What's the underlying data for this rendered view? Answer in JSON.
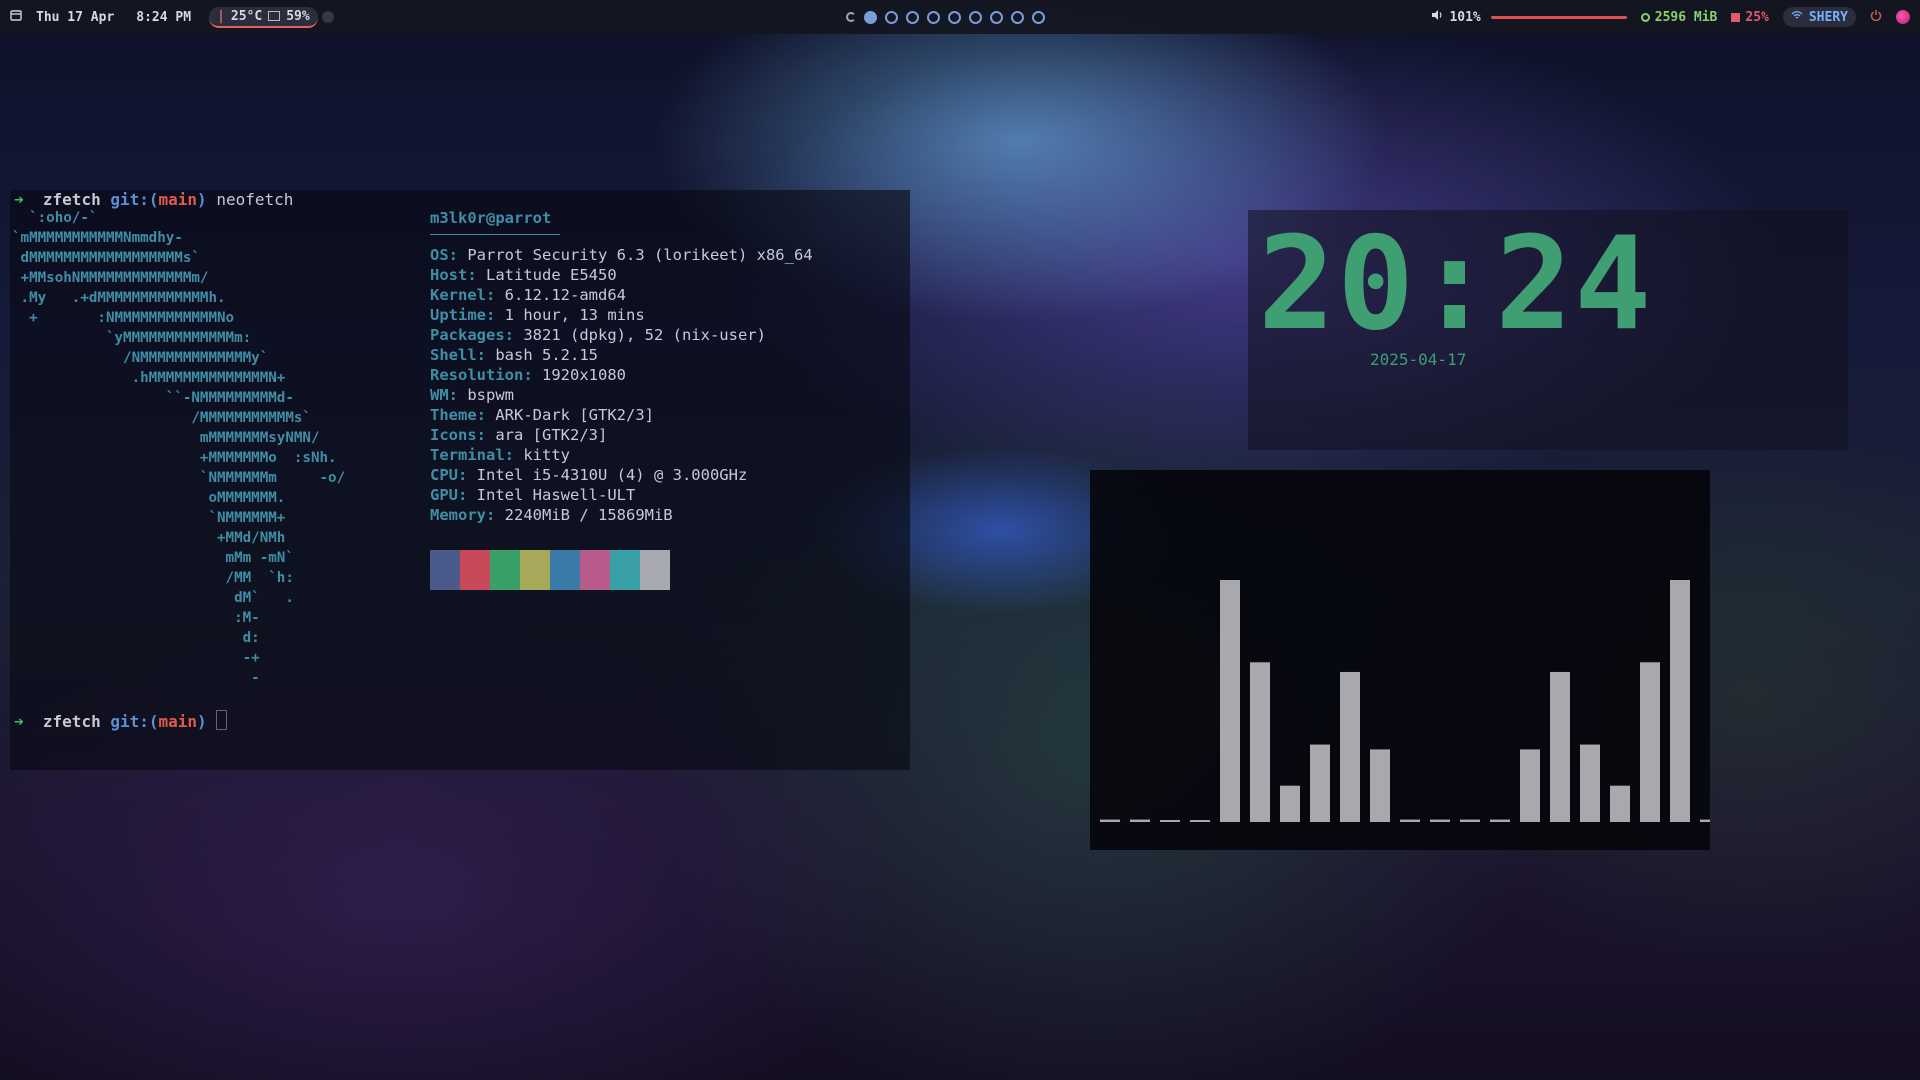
{
  "topbar": {
    "date": "Thu 17 Apr",
    "time": "8:24 PM",
    "temp": "25°C",
    "battery": "59%",
    "workspaces": [
      {
        "active": true
      },
      {
        "active": false
      },
      {
        "active": false
      },
      {
        "active": false
      },
      {
        "active": false
      },
      {
        "active": false
      },
      {
        "active": false
      },
      {
        "active": false
      },
      {
        "active": false
      }
    ],
    "volume": "101%",
    "volume_level": 1.01,
    "memory": "2596 MiB",
    "cpu": "25%",
    "wifi": "SHERY",
    "colors": {
      "accent": "#7a9cd8",
      "volume_bar": "#e05050",
      "memory": "#8bd06a",
      "cpu": "#e05a6a"
    }
  },
  "terminal": {
    "prompt1": {
      "arrow": "➜",
      "dir": "zfetch",
      "git": "git:(",
      "branch": "main",
      "git_close": ")",
      "command": "neofetch"
    },
    "prompt2": {
      "arrow": "➜",
      "dir": "zfetch",
      "git": "git:(",
      "branch": "main",
      "git_close": ")"
    },
    "ascii_art": "  `:oho/-`\n`mMMMMMMMMMMMNmmdhy-\n dMMMMMMMMMMMMMMMMMMs`\n +MMsohNMMMMMMMMMMMMMm/\n .My   .+dMMMMMMMMMMMMMh.\n  +       :NMMMMMMMMMMMMNo\n           `yMMMMMMMMMMMMMm:\n             /NMMMMMMMMMMMMMy`\n              .hMMMMMMMMMMMMMMN+\n                  ``-NMMMMMMMMMd-\n                     /MMMMMMMMMMMs`\n                      mMMMMMMMsyNMN/\n                      +MMMMMMMo  :sNh.\n                      `NMMMMMMm     -o/\n                       oMMMMMMM.\n                       `NMMMMMM+\n                        +MMd/NMh\n                         mMm -mN`\n                         /MM  `h:\n                          dM`   .\n                          :M-\n                           d:\n                           -+\n                            -",
    "fetch": {
      "title": "m3lk0r@parrot",
      "rows": [
        {
          "key": "OS",
          "value": "Parrot Security 6.3 (lorikeet) x86_64"
        },
        {
          "key": "Host",
          "value": "Latitude E5450"
        },
        {
          "key": "Kernel",
          "value": "6.12.12-amd64"
        },
        {
          "key": "Uptime",
          "value": "1 hour, 13 mins"
        },
        {
          "key": "Packages",
          "value": "3821 (dpkg), 52 (nix-user)"
        },
        {
          "key": "Shell",
          "value": "bash 5.2.15"
        },
        {
          "key": "Resolution",
          "value": "1920x1080"
        },
        {
          "key": "WM",
          "value": "bspwm"
        },
        {
          "key": "Theme",
          "value": "ARK-Dark [GTK2/3]"
        },
        {
          "key": "Icons",
          "value": "ara [GTK2/3]"
        },
        {
          "key": "Terminal",
          "value": "kitty"
        },
        {
          "key": "CPU",
          "value": "Intel i5-4310U (4) @ 3.000GHz"
        },
        {
          "key": "GPU",
          "value": "Intel Haswell-ULT"
        },
        {
          "key": "Memory",
          "value": "2240MiB / 15869MiB"
        }
      ],
      "palette": [
        "#4a5a8a",
        "#c84a5a",
        "#3aa06a",
        "#a8a85a",
        "#3a7aa8",
        "#b85a8a",
        "#3aa0a8",
        "#a8a8b0"
      ]
    }
  },
  "clock": {
    "time": "20:24",
    "date": "2025-04-17",
    "color": "#3f9e72"
  },
  "visualizer": {
    "levels": [
      0.01,
      0.01,
      0.0,
      0.0,
      1.0,
      0.66,
      0.15,
      0.32,
      0.62,
      0.3,
      0.01,
      0.01,
      0.01,
      0.01,
      0.3,
      0.62,
      0.32,
      0.15,
      0.66,
      1.0,
      0.01,
      0.01
    ],
    "bar_color": "#a9a9ad"
  }
}
